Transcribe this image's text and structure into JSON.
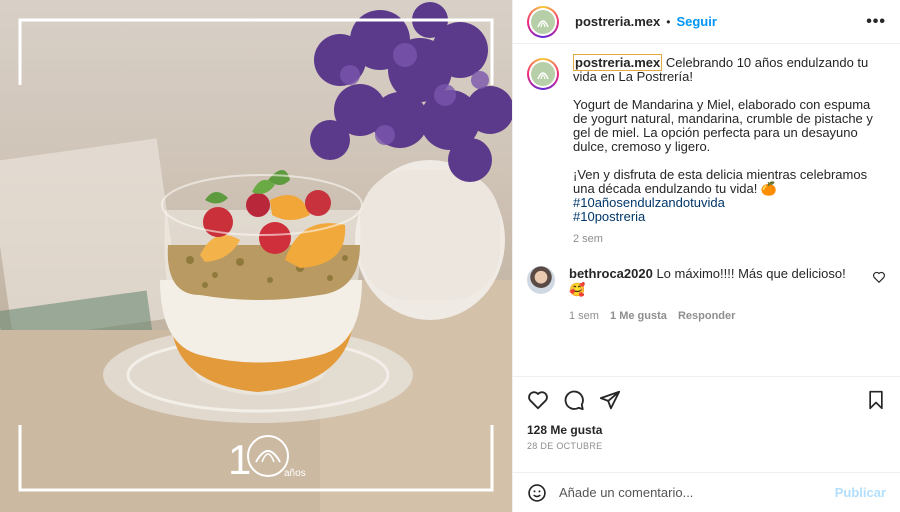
{
  "post": {
    "username": "postreria.mex",
    "follow_label": "Seguir",
    "separator": "•",
    "more_label": "•••"
  },
  "photo": {
    "overlay_number": "1",
    "overlay_suffix": "0",
    "overlay_word": "años"
  },
  "caption": {
    "username": "postreria.mex",
    "line1": " Celebrando 10 años endulzando tu vida en La Postrería!",
    "para2": "Yogurt de Mandarina y Miel, elaborado con espuma de yogurt natural, mandarina, crumble de pistache y gel de miel. La opción perfecta para un desayuno dulce, cremoso y ligero.",
    "para3": "¡Ven y disfruta de esta delicia mientras celebramos una década endulzando tu vida! 🍊",
    "hashtag1": "#10añosendulzandotuvida",
    "hashtag2": "#10postreria",
    "time": "2 sem"
  },
  "comment": {
    "username": "bethroca2020",
    "text": " Lo máximo!!!! Más que delicioso! 🥰",
    "time": "1 sem",
    "likes": "1 Me gusta",
    "reply": "Responder"
  },
  "stats": {
    "likes": "128 Me gusta",
    "date": "28 DE OCTUBRE"
  },
  "add_comment": {
    "placeholder": "Añade un comentario...",
    "publish": "Publicar"
  },
  "colors": {
    "link": "#0095f6",
    "hashtag": "#00376b",
    "muted": "#8e8e8e",
    "publish_disabled": "#b2dffc"
  },
  "icons": [
    "heart-icon",
    "comment-icon",
    "share-icon",
    "bookmark-icon",
    "emoji-icon",
    "more-icon"
  ]
}
